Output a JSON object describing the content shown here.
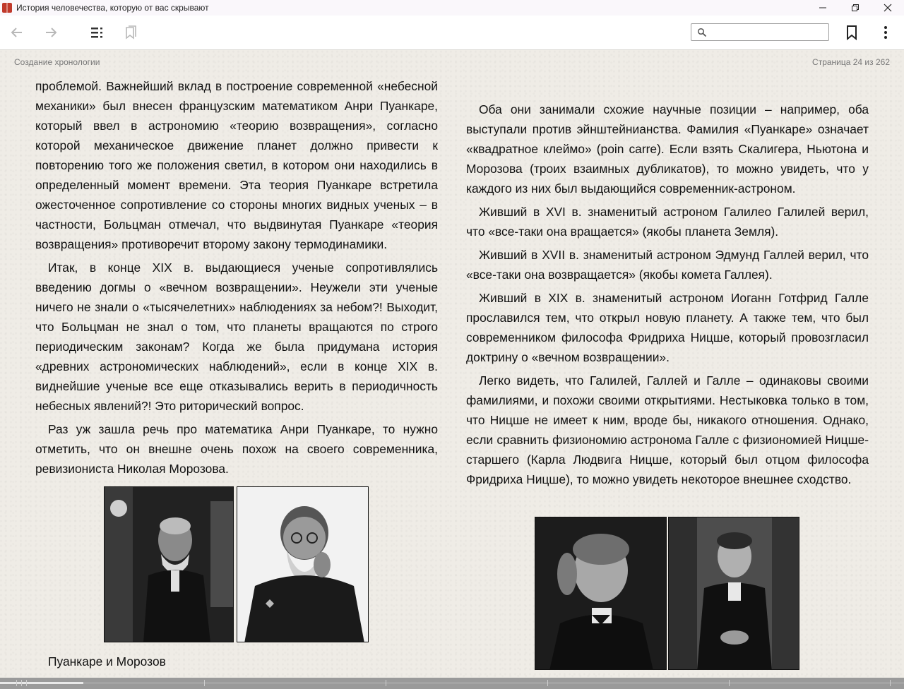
{
  "window": {
    "title": "История человечества, которую от вас скрывают",
    "controls": {
      "minimize": "—",
      "maximize": "❐",
      "close": "✕"
    }
  },
  "toolbar": {
    "back_icon": "arrow-left-icon",
    "forward_icon": "arrow-right-icon",
    "toc_icon": "table-of-contents-icon",
    "bookmarks_list_icon": "bookmarks-icon",
    "search": {
      "value": "",
      "placeholder": ""
    },
    "bookmark_icon": "bookmark-icon",
    "menu_icon": "more-vertical-icon"
  },
  "reader": {
    "chapter": "Создание хронологии",
    "page_indicator": "Страница 24 из 262",
    "progress_fraction": 0.092,
    "left_page": {
      "paragraphs": [
        "проблемой. Важнейший вклад в построение современной «небесной механики» был внесен французским математиком Анри Пуанкаре, который ввел в астрономию «теорию возвращения», согласно которой механическое движение планет должно привести к повторению того же положения светил, в котором они находились в определенный момент времени. Эта теория Пуанкаре встретила ожесточенное сопротивление со стороны многих видных ученых – в частности, Больцман отмечал, что выдвинутая Пуанкаре «теория возвращения» противоречит второму закону термодинамики.",
        "Итак, в конце XIX в. выдающиеся ученые сопротивлялись введению догмы о «вечном возвращении». Неужели эти ученые ничего не знали о «тысячелетних» наблюдениях за небом?! Выходит, что Больцман не знал о том, что планеты вращаются по строго периодическим законам? Когда же была придумана история «древних астрономических наблюдений», если в конце XIX в. виднейшие ученые все еще отказывались верить в периодичность небесных явлений?! Это риторический вопрос.",
        "Раз уж зашла речь про математика Анри Пуанкаре, то нужно отметить, что он внешне очень похож на своего современника, ревизиониста Николая Морозова."
      ],
      "caption": "Пуанкаре и Морозов"
    },
    "right_page": {
      "paragraphs": [
        "Оба они занимали схожие научные позиции – например, оба выступали против эйнштейнианства. Фамилия «Пуанкаре» означает «квадратное клеймо» (poin carre). Если взять Скалигера, Ньютона и Морозова (троих взаимных дубликатов), то можно увидеть, что у каждого из них был выдающийся современник-астроном.",
        "Живший в XVI в. знаменитый астроном Галилео Галилей верил, что «все-таки она вращается» (якобы планета Земля).",
        "Живший в XVII в. знаменитый астроном Эдмунд Галлей верил, что «все-таки она возвращается» (якобы комета Галлея).",
        "Живший в XIX в. знаменитый астроном Иоганн Готфрид Галле прославился тем, что открыл новую планету. А также тем, что был современником философа Фридриха Ницше, который провозгласил доктрину о «вечном возвращении».",
        "Легко видеть, что Галилей, Галлей и Галле – одинаковы своими фамилиями, и похожи своими открытиями. Нестыковка только в том, что Ницше не имеет к ним, вроде бы, никакого отношения. Однако, если сравнить физиономию астронома Галле с физиономией Ницше-старшего (Карла Людвига Ницше, который был отцом философа Фридриха Ницше), то можно увидеть некоторое внешнее сходство."
      ]
    }
  },
  "colors": {
    "page_background": "#efece6",
    "toolbar_background": "#ffffff",
    "titlebar_background": "#faf7fb",
    "progress_background": "#9a9a9a"
  }
}
